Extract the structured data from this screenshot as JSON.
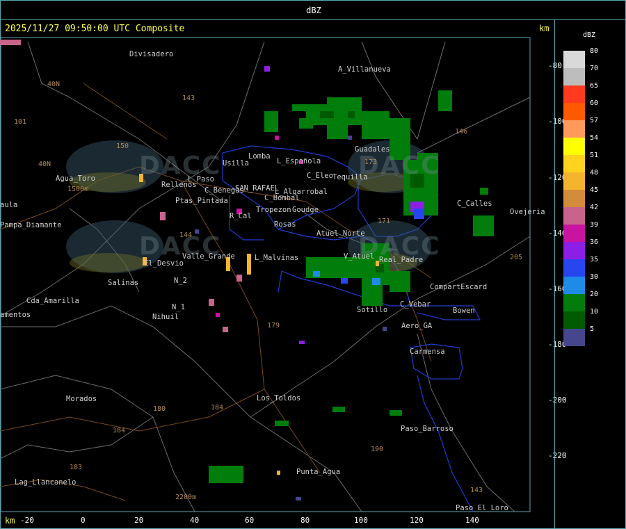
{
  "header": {
    "title": "dBZ"
  },
  "map": {
    "timestamp": "2025/11/27 09:50:00 UTC Composite",
    "unit_top": "km",
    "unit_bottom": "km",
    "y_ticks": [
      "-80",
      "-100",
      "-120",
      "-140",
      "-160",
      "-180",
      "-200",
      "-220"
    ],
    "x_ticks": [
      "-20",
      "0",
      "20",
      "40",
      "60",
      "80",
      "100",
      "120",
      "140"
    ],
    "watermark": "DACC",
    "places": [
      "Divisadero",
      "A_Villanueva",
      "Usilla",
      "Lomba",
      "L_Española",
      "C_Eleo",
      "Tequilla",
      "Guadales",
      "Agua_Toro",
      "Rellenos",
      "L_Paso",
      "C_Benegas",
      "SAN_RAFAEL",
      "L_Algarrobal",
      "C_Bombal",
      "Ptas_Pintada",
      "Pampa_Diamante",
      "Tropezon",
      "Goudge",
      "R_Cal",
      "Rosas",
      "Atuel_Norte",
      "El_Desvio",
      "Valle_Grande",
      "L_Malvinas",
      "V_Atuel",
      "Real_Padre",
      "Salinas",
      "N_2",
      "Cda_Amarilla",
      "N_1",
      "Nihuil",
      "CompartEscard",
      "Bowen",
      "Sotillo",
      "C_Vebar",
      "Aero_GA",
      "Carmensa",
      "Morados",
      "Los_Toldos",
      "Paso_Barroso",
      "Punta_Agua",
      "Lag_Llancanelo",
      "Paso_El_Loro",
      "C_Calles",
      "Ovejeria",
      "aula",
      "amentos"
    ],
    "roads": [
      "40N",
      "101",
      "143",
      "150",
      "146",
      "40N",
      "144",
      "171",
      "180",
      "184",
      "190",
      "179",
      "183",
      "184",
      "143",
      "173",
      "205",
      "2200m",
      "1500m"
    ]
  },
  "legend": {
    "title": "dBZ",
    "levels": [
      {
        "label": "80",
        "color": "#d9d9d9"
      },
      {
        "label": "70",
        "color": "#bdbdbd"
      },
      {
        "label": "65",
        "color": "#ff3a1e"
      },
      {
        "label": "60",
        "color": "#ff5a00"
      },
      {
        "label": "57",
        "color": "#ff9a5a"
      },
      {
        "label": "54",
        "color": "#ffff00"
      },
      {
        "label": "51",
        "color": "#ffd21e"
      },
      {
        "label": "48",
        "color": "#f5b42d"
      },
      {
        "label": "45",
        "color": "#d28c3c"
      },
      {
        "label": "42",
        "color": "#c8648c"
      },
      {
        "label": "39",
        "color": "#c814a0"
      },
      {
        "label": "36",
        "color": "#8c1ee6"
      },
      {
        "label": "35",
        "color": "#2846f0"
      },
      {
        "label": "30",
        "color": "#1e8ce6"
      },
      {
        "label": "20",
        "color": "#007d0a"
      },
      {
        "label": "10",
        "color": "#005a00"
      },
      {
        "label": "5",
        "color": "#46468c"
      }
    ]
  }
}
